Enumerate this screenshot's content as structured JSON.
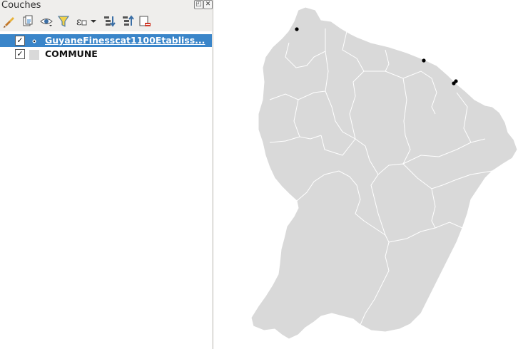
{
  "panel": {
    "title": "Couches",
    "title_buttons": [
      "float-icon",
      "close-icon"
    ]
  },
  "toolbar": {
    "icons": [
      "style-brush-icon",
      "add-group-icon",
      "visibility-eye-icon",
      "filter-icon",
      "expression-filter-icon",
      "expand-all-icon",
      "collapse-all-icon",
      "remove-layer-icon"
    ]
  },
  "layers": [
    {
      "label": "GuyaneFinesscat1100Etabliss...",
      "checked": true,
      "selected": true,
      "symbol": "point-icon"
    },
    {
      "label": "COMMUNE",
      "checked": true,
      "selected": false,
      "symbol": "polygon-fill-icon"
    }
  ],
  "map": {
    "fill_color": "#d9d9d9",
    "stroke_color": "#ffffff",
    "point_color": "#000000",
    "points_count": 4
  }
}
